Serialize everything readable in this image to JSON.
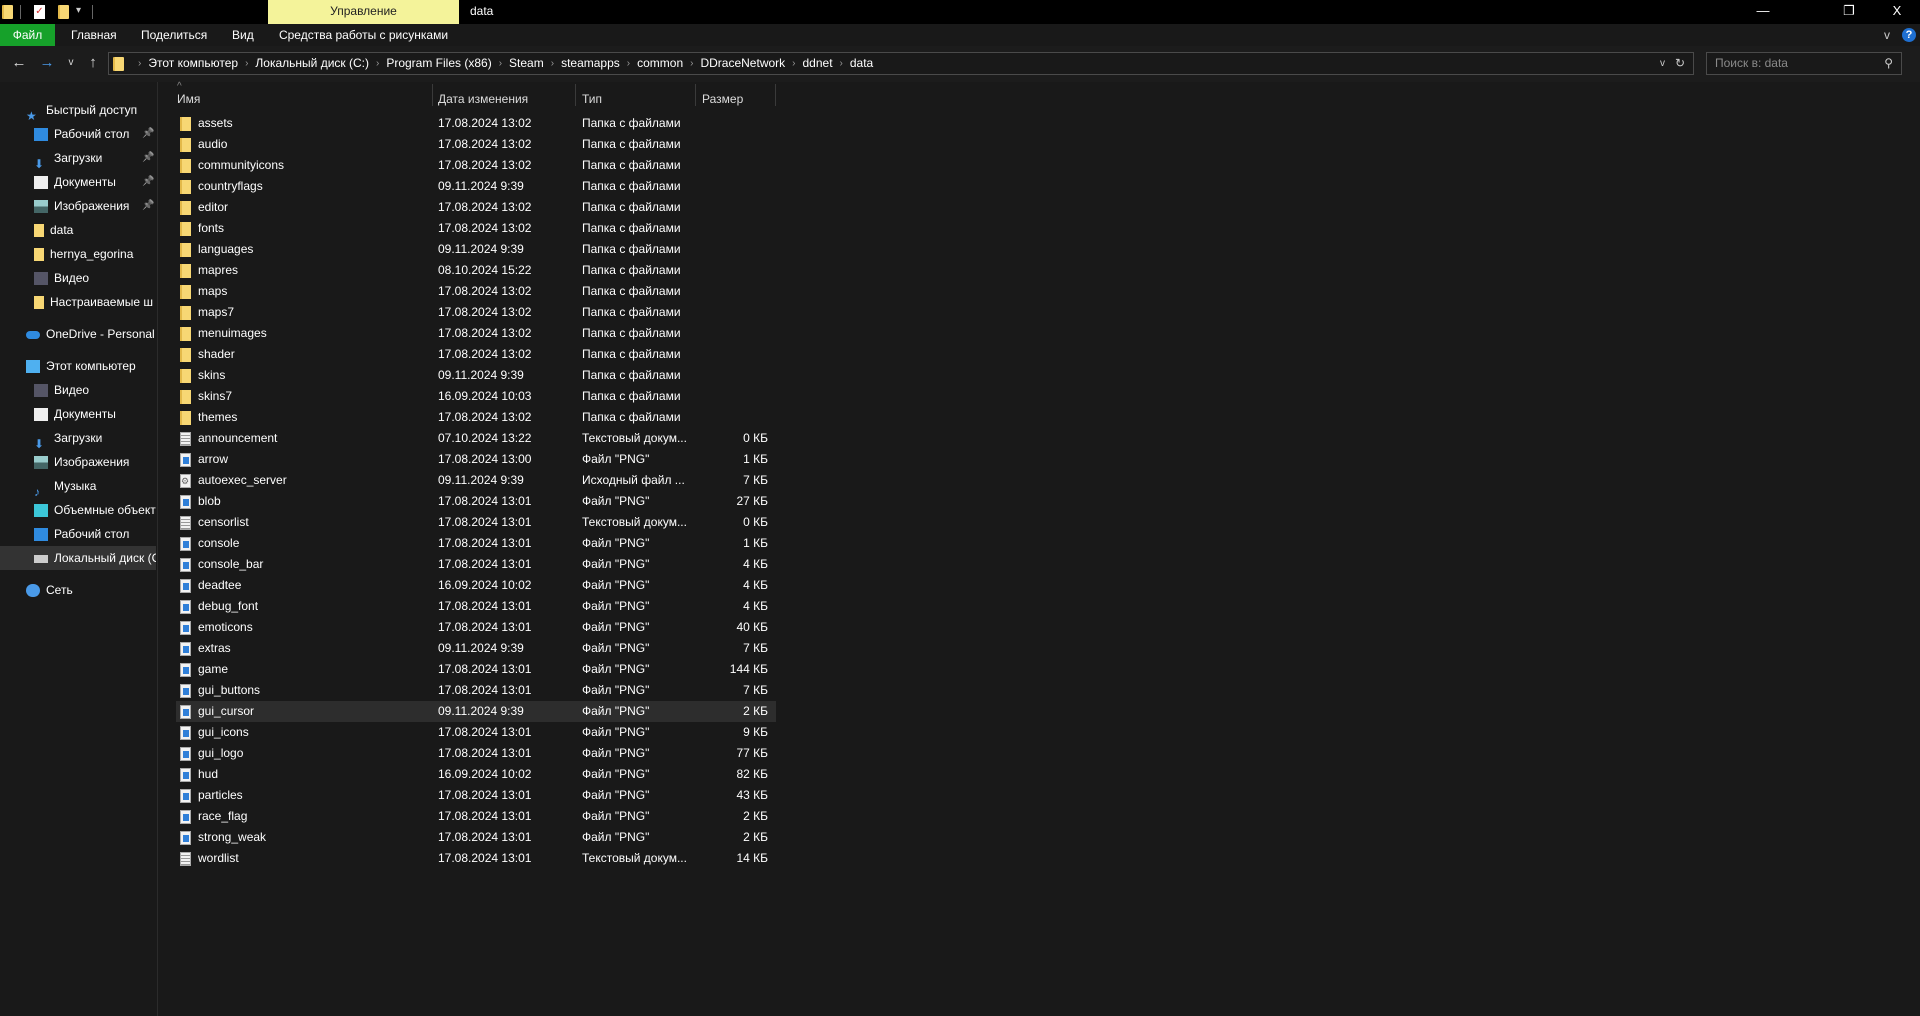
{
  "window": {
    "title": "data",
    "manage_tab": "Управление",
    "minimize": "—",
    "restore": "❐",
    "close": "X"
  },
  "ribbon": {
    "tabs": [
      "Файл",
      "Главная",
      "Поделиться",
      "Вид"
    ],
    "tools_tab": "Средства работы с рисунками",
    "expand": "v",
    "help": "?"
  },
  "address": {
    "crumbs": [
      "Этот компьютер",
      "Локальный диск (C:)",
      "Program Files (x86)",
      "Steam",
      "steamapps",
      "common",
      "DDraceNetwork",
      "ddnet",
      "data"
    ],
    "dropdown": "v",
    "refresh": "↻"
  },
  "search": {
    "placeholder": "Поиск в: data",
    "icon": "search-icon"
  },
  "sidebar": {
    "items": [
      {
        "label": "Быстрый доступ",
        "icon": "star",
        "level": 0
      },
      {
        "label": "Рабочий стол",
        "icon": "desktop",
        "level": 1,
        "pinned": true
      },
      {
        "label": "Загрузки",
        "icon": "download",
        "level": 1,
        "pinned": true
      },
      {
        "label": "Документы",
        "icon": "document",
        "level": 1,
        "pinned": true
      },
      {
        "label": "Изображения",
        "icon": "pictures",
        "level": 1,
        "pinned": true
      },
      {
        "label": "data",
        "icon": "folder",
        "level": 1
      },
      {
        "label": "hernya_egorina",
        "icon": "folder",
        "level": 1
      },
      {
        "label": "Видео",
        "icon": "video",
        "level": 1
      },
      {
        "label": "Настраиваемые ш",
        "icon": "folder",
        "level": 1
      },
      {
        "label": "OneDrive - Personal",
        "icon": "cloud",
        "level": 0,
        "gap": true
      },
      {
        "label": "Этот компьютер",
        "icon": "computer",
        "level": 0,
        "gap": true
      },
      {
        "label": "Видео",
        "icon": "video",
        "level": 1
      },
      {
        "label": "Документы",
        "icon": "document",
        "level": 1
      },
      {
        "label": "Загрузки",
        "icon": "download",
        "level": 1
      },
      {
        "label": "Изображения",
        "icon": "pictures",
        "level": 1
      },
      {
        "label": "Музыка",
        "icon": "music",
        "level": 1
      },
      {
        "label": "Объемные объекті",
        "icon": "3d-objects",
        "level": 1
      },
      {
        "label": "Рабочий стол",
        "icon": "desktop",
        "level": 1
      },
      {
        "label": "Локальный диск (C",
        "icon": "drive",
        "level": 1,
        "selected": true
      },
      {
        "label": "Сеть",
        "icon": "network",
        "level": 0,
        "gap": true
      }
    ]
  },
  "columns": {
    "name": "Имя",
    "date": "Дата изменения",
    "type": "Тип",
    "size": "Размер",
    "sort_indicator": "^"
  },
  "files": [
    {
      "name": "assets",
      "date": "17.08.2024 13:02",
      "type": "Папка с файлами",
      "size": "",
      "kind": "folder"
    },
    {
      "name": "audio",
      "date": "17.08.2024 13:02",
      "type": "Папка с файлами",
      "size": "",
      "kind": "folder"
    },
    {
      "name": "communityicons",
      "date": "17.08.2024 13:02",
      "type": "Папка с файлами",
      "size": "",
      "kind": "folder"
    },
    {
      "name": "countryflags",
      "date": "09.11.2024 9:39",
      "type": "Папка с файлами",
      "size": "",
      "kind": "folder"
    },
    {
      "name": "editor",
      "date": "17.08.2024 13:02",
      "type": "Папка с файлами",
      "size": "",
      "kind": "folder"
    },
    {
      "name": "fonts",
      "date": "17.08.2024 13:02",
      "type": "Папка с файлами",
      "size": "",
      "kind": "folder"
    },
    {
      "name": "languages",
      "date": "09.11.2024 9:39",
      "type": "Папка с файлами",
      "size": "",
      "kind": "folder"
    },
    {
      "name": "mapres",
      "date": "08.10.2024 15:22",
      "type": "Папка с файлами",
      "size": "",
      "kind": "folder"
    },
    {
      "name": "maps",
      "date": "17.08.2024 13:02",
      "type": "Папка с файлами",
      "size": "",
      "kind": "folder"
    },
    {
      "name": "maps7",
      "date": "17.08.2024 13:02",
      "type": "Папка с файлами",
      "size": "",
      "kind": "folder"
    },
    {
      "name": "menuimages",
      "date": "17.08.2024 13:02",
      "type": "Папка с файлами",
      "size": "",
      "kind": "folder"
    },
    {
      "name": "shader",
      "date": "17.08.2024 13:02",
      "type": "Папка с файлами",
      "size": "",
      "kind": "folder"
    },
    {
      "name": "skins",
      "date": "09.11.2024 9:39",
      "type": "Папка с файлами",
      "size": "",
      "kind": "folder"
    },
    {
      "name": "skins7",
      "date": "16.09.2024 10:03",
      "type": "Папка с файлами",
      "size": "",
      "kind": "folder"
    },
    {
      "name": "themes",
      "date": "17.08.2024 13:02",
      "type": "Папка с файлами",
      "size": "",
      "kind": "folder"
    },
    {
      "name": "announcement",
      "date": "07.10.2024 13:22",
      "type": "Текстовый докум...",
      "size": "0 КБ",
      "kind": "txt"
    },
    {
      "name": "arrow",
      "date": "17.08.2024 13:00",
      "type": "Файл \"PNG\"",
      "size": "1 КБ",
      "kind": "png"
    },
    {
      "name": "autoexec_server",
      "date": "09.11.2024 9:39",
      "type": "Исходный файл ...",
      "size": "7 КБ",
      "kind": "cfg"
    },
    {
      "name": "blob",
      "date": "17.08.2024 13:01",
      "type": "Файл \"PNG\"",
      "size": "27 КБ",
      "kind": "png"
    },
    {
      "name": "censorlist",
      "date": "17.08.2024 13:01",
      "type": "Текстовый докум...",
      "size": "0 КБ",
      "kind": "txt"
    },
    {
      "name": "console",
      "date": "17.08.2024 13:01",
      "type": "Файл \"PNG\"",
      "size": "1 КБ",
      "kind": "png"
    },
    {
      "name": "console_bar",
      "date": "17.08.2024 13:01",
      "type": "Файл \"PNG\"",
      "size": "4 КБ",
      "kind": "png"
    },
    {
      "name": "deadtee",
      "date": "16.09.2024 10:02",
      "type": "Файл \"PNG\"",
      "size": "4 КБ",
      "kind": "png"
    },
    {
      "name": "debug_font",
      "date": "17.08.2024 13:01",
      "type": "Файл \"PNG\"",
      "size": "4 КБ",
      "kind": "png"
    },
    {
      "name": "emoticons",
      "date": "17.08.2024 13:01",
      "type": "Файл \"PNG\"",
      "size": "40 КБ",
      "kind": "png"
    },
    {
      "name": "extras",
      "date": "09.11.2024 9:39",
      "type": "Файл \"PNG\"",
      "size": "7 КБ",
      "kind": "png"
    },
    {
      "name": "game",
      "date": "17.08.2024 13:01",
      "type": "Файл \"PNG\"",
      "size": "144 КБ",
      "kind": "png"
    },
    {
      "name": "gui_buttons",
      "date": "17.08.2024 13:01",
      "type": "Файл \"PNG\"",
      "size": "7 КБ",
      "kind": "png"
    },
    {
      "name": "gui_cursor",
      "date": "09.11.2024 9:39",
      "type": "Файл \"PNG\"",
      "size": "2 КБ",
      "kind": "png",
      "hover": true
    },
    {
      "name": "gui_icons",
      "date": "17.08.2024 13:01",
      "type": "Файл \"PNG\"",
      "size": "9 КБ",
      "kind": "png"
    },
    {
      "name": "gui_logo",
      "date": "17.08.2024 13:01",
      "type": "Файл \"PNG\"",
      "size": "77 КБ",
      "kind": "png"
    },
    {
      "name": "hud",
      "date": "16.09.2024 10:02",
      "type": "Файл \"PNG\"",
      "size": "82 КБ",
      "kind": "png"
    },
    {
      "name": "particles",
      "date": "17.08.2024 13:01",
      "type": "Файл \"PNG\"",
      "size": "43 КБ",
      "kind": "png"
    },
    {
      "name": "race_flag",
      "date": "17.08.2024 13:01",
      "type": "Файл \"PNG\"",
      "size": "2 КБ",
      "kind": "png"
    },
    {
      "name": "strong_weak",
      "date": "17.08.2024 13:01",
      "type": "Файл \"PNG\"",
      "size": "2 КБ",
      "kind": "png"
    },
    {
      "name": "wordlist",
      "date": "17.08.2024 13:01",
      "type": "Текстовый докум...",
      "size": "14 КБ",
      "kind": "txt"
    }
  ],
  "colors": {
    "file_tab": "#16a12a",
    "manage_tab": "#f4f39a",
    "folder": "#f7d774",
    "hover_row": "#2d2d2d"
  }
}
